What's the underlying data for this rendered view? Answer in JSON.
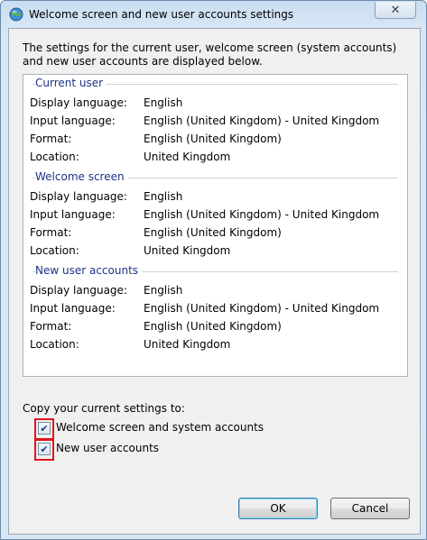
{
  "window": {
    "title": "Welcome screen and new user accounts settings",
    "close_glyph": "✕"
  },
  "intro_text": "The settings for the current user, welcome screen (system accounts) and new user accounts are displayed below.",
  "sections": [
    {
      "heading": "Current user",
      "rows": [
        {
          "label": "Display language:",
          "value": "English"
        },
        {
          "label": "Input language:",
          "value": "English (United Kingdom) - United Kingdom"
        },
        {
          "label": "Format:",
          "value": "English (United Kingdom)"
        },
        {
          "label": "Location:",
          "value": "United Kingdom"
        }
      ]
    },
    {
      "heading": "Welcome screen",
      "rows": [
        {
          "label": "Display language:",
          "value": "English"
        },
        {
          "label": "Input language:",
          "value": "English (United Kingdom) - United Kingdom"
        },
        {
          "label": "Format:",
          "value": "English (United Kingdom)"
        },
        {
          "label": "Location:",
          "value": "United Kingdom"
        }
      ]
    },
    {
      "heading": "New user accounts",
      "rows": [
        {
          "label": "Display language:",
          "value": "English"
        },
        {
          "label": "Input language:",
          "value": "English (United Kingdom) - United Kingdom"
        },
        {
          "label": "Format:",
          "value": "English (United Kingdom)"
        },
        {
          "label": "Location:",
          "value": "United Kingdom"
        }
      ]
    }
  ],
  "copy": {
    "label": "Copy your current settings to:",
    "checkboxes": [
      {
        "label": "Welcome screen and system accounts",
        "checked": true,
        "mark": "✔"
      },
      {
        "label": "New user accounts",
        "checked": true,
        "mark": "✔"
      }
    ]
  },
  "buttons": {
    "ok": "OK",
    "cancel": "Cancel"
  },
  "colors": {
    "section_heading": "#1e3287",
    "highlight_outline": "#e0141e"
  }
}
